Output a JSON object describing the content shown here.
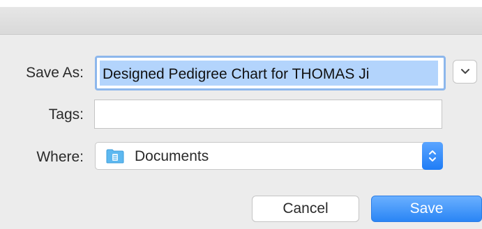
{
  "dialog": {
    "save_as_label": "Save As:",
    "save_as_value": "Designed Pedigree Chart for THOMAS Ji",
    "tags_label": "Tags:",
    "tags_value": "",
    "where_label": "Where:",
    "where_value": "Documents",
    "cancel_label": "Cancel",
    "save_label": "Save",
    "icons": {
      "expand": "chevron-down-icon",
      "folder": "folder-icon",
      "stepper": "up-down-chevron-icon"
    },
    "colors": {
      "accent": "#2a85f5",
      "selection": "#b3d4fc",
      "focus_ring": "#8db7ec",
      "folder": "#5db8f0"
    }
  }
}
